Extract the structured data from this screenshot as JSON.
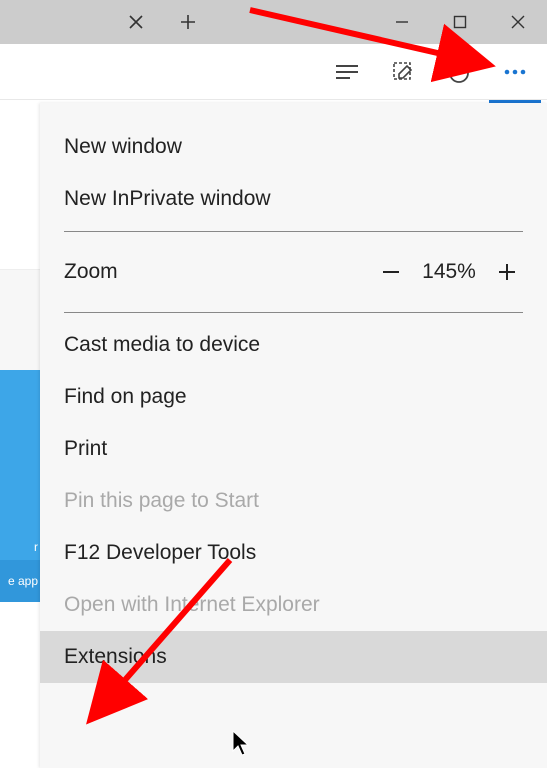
{
  "titlebar": {
    "close_tab_symbol": "✕",
    "new_tab_symbol": "+"
  },
  "toolbar": {
    "hub_icon": "hub-icon",
    "notes_icon": "webnote-icon",
    "share_icon": "share-icon",
    "more_icon": "more-icon"
  },
  "menu": {
    "new_window": "New window",
    "new_inprivate": "New InPrivate window",
    "zoom_label": "Zoom",
    "zoom_value": "145%",
    "cast": "Cast media to device",
    "find": "Find on page",
    "print": "Print",
    "pin": "Pin this page to Start",
    "devtools": "F12 Developer Tools",
    "open_ie": "Open with Internet Explorer",
    "extensions": "Extensions"
  },
  "sidebar": {
    "r_fragment": "r",
    "get_app": "e app"
  }
}
